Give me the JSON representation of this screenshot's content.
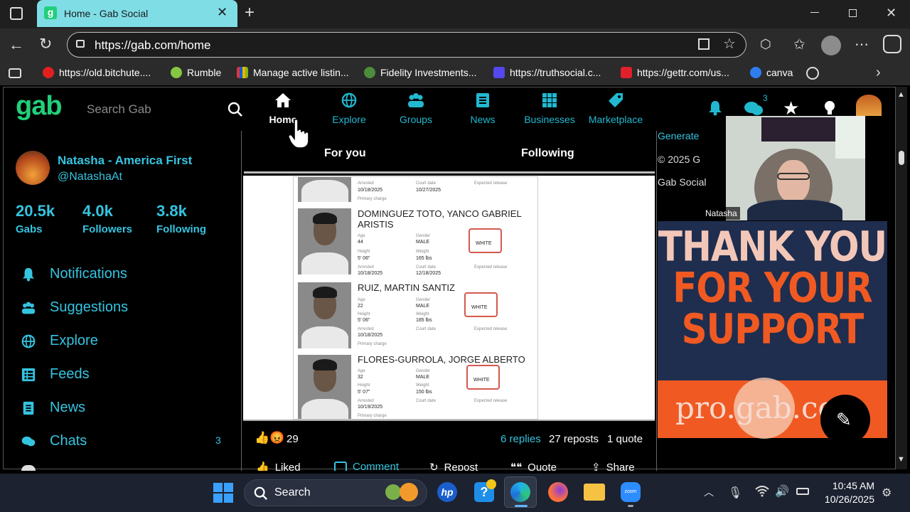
{
  "browser": {
    "tab_title": "Home - Gab Social",
    "url": "https://gab.com/home",
    "favorites": [
      {
        "label": "https://old.bitchute....",
        "color": "#e02020"
      },
      {
        "label": "Rumble",
        "color": "#85c742"
      },
      {
        "label": "Manage active listin...",
        "color": "#f5af02"
      },
      {
        "label": "Fidelity Investments...",
        "color": "#4c8c3c"
      },
      {
        "label": "https://truthsocial.c...",
        "color": "#5448ee"
      },
      {
        "label": "https://gettr.com/us...",
        "color": "#e0202a"
      },
      {
        "label": "canva",
        "color": "#2e7ef0"
      }
    ]
  },
  "gab": {
    "logo": "gab",
    "search_placeholder": "Search Gab",
    "nav": [
      {
        "label": "Home",
        "icon": "home-icon"
      },
      {
        "label": "Explore",
        "icon": "globe-icon"
      },
      {
        "label": "Groups",
        "icon": "groups-icon"
      },
      {
        "label": "News",
        "icon": "news-icon"
      },
      {
        "label": "Businesses",
        "icon": "businesses-icon"
      },
      {
        "label": "Marketplace",
        "icon": "tag-icon"
      }
    ],
    "chat_badge": "3",
    "profile": {
      "name": "Natasha - America First",
      "handle": "@NatashaAt",
      "gabs": "20.5k",
      "gabs_label": "Gabs",
      "followers": "4.0k",
      "followers_label": "Followers",
      "following": "3.8k",
      "following_label": "Following"
    },
    "sidebar": [
      {
        "label": "Notifications",
        "icon": "bell-icon"
      },
      {
        "label": "Suggestions",
        "icon": "users-icon"
      },
      {
        "label": "Explore",
        "icon": "globe-icon"
      },
      {
        "label": "Feeds",
        "icon": "list-icon"
      },
      {
        "label": "News",
        "icon": "news-icon"
      },
      {
        "label": "Chats",
        "icon": "chat-icon",
        "badge": "3"
      }
    ],
    "feed_tabs": {
      "for_you": "For you",
      "following": "Following"
    },
    "right_snippets": {
      "generate": "Generate",
      "copyright": "© 2025 G",
      "gab_social": "Gab Social"
    },
    "post": {
      "people": [
        {
          "name_l1": "DOMINGUEZ TOTO, YANCO GABRIEL",
          "name_l2": "ARISTIS",
          "age": "44",
          "gender": "MALE",
          "race": "WHITE",
          "height": "5' 06\"",
          "weight": "165 lbs",
          "arrested": "10/18/2025",
          "court": "12/18/2025"
        },
        {
          "name_l1": "RUIZ, MARTIN SANTIZ",
          "name_l2": "",
          "age": "22",
          "gender": "MALE",
          "race": "WHITE",
          "height": "5' 06\"",
          "weight": "185 lbs",
          "arrested": "10/18/2025",
          "court": ""
        },
        {
          "name_l1": "FLORES-GURROLA, JORGE ALBERTO",
          "name_l2": "",
          "age": "32",
          "gender": "MALE",
          "race": "WHITE",
          "height": "5' 07\"",
          "weight": "150 lbs",
          "arrested": "10/19/2025",
          "court": ""
        }
      ],
      "top_row": {
        "arrested": "10/18/2025",
        "court": "10/27/2025"
      },
      "field_labels": {
        "age": "Age",
        "gender": "Gender",
        "race": "Race",
        "height": "Height",
        "weight": "Weight",
        "arrested": "Arrested",
        "court": "Court date",
        "release": "Expected release",
        "charge": "Primary charge"
      },
      "reactions": "29",
      "replies": "6 replies",
      "reposts": "27 reposts",
      "quotes": "1 quote",
      "actions": {
        "liked": "Liked",
        "comment": "Comment",
        "repost": "Repost",
        "quote": "Quote",
        "share": "Share"
      }
    },
    "video_label": "Natasha",
    "banner": {
      "line1": "THANK YOU",
      "line2": "FOR YOUR",
      "line3": "SUPPORT",
      "url": "pro.gab.co"
    }
  },
  "taskbar": {
    "search": "Search",
    "time": "10:45 AM",
    "date": "10/26/2025"
  },
  "colors": {
    "accent": "#35c4e0",
    "gab_green": "#21cf7a",
    "tab": "#7fdde6",
    "banner_orange": "#f05a22"
  }
}
